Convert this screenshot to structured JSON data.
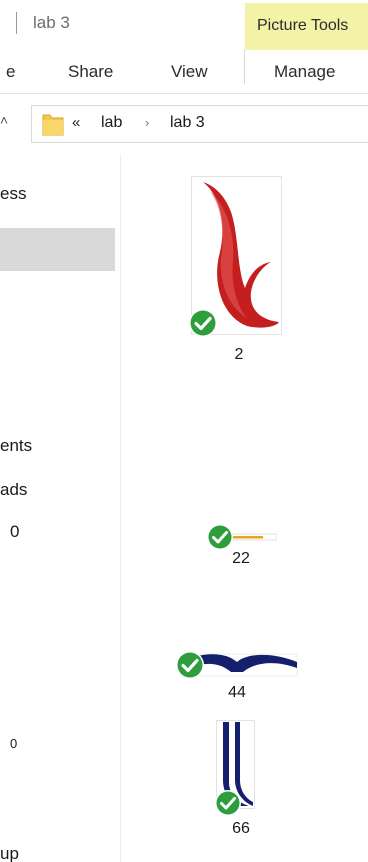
{
  "window": {
    "title": "lab 3",
    "context_tab": "Picture Tools"
  },
  "ribbon": {
    "tabs": [
      {
        "label": "e"
      },
      {
        "label": "Share"
      },
      {
        "label": "View"
      },
      {
        "label": "Manage"
      }
    ]
  },
  "address_bar": {
    "overflow": "«",
    "crumbs": [
      "lab",
      "lab 3"
    ]
  },
  "nav_pane": {
    "items": [
      "ess",
      "ents",
      "ads",
      "0",
      "0",
      "up"
    ]
  },
  "files": [
    {
      "name": "2",
      "status": "synced"
    },
    {
      "name": "22",
      "status": "synced"
    },
    {
      "name": "44",
      "status": "synced"
    },
    {
      "name": "66",
      "status": "synced"
    }
  ],
  "colors": {
    "context_tab_bg": "#f4f2a6",
    "selected_bg": "#d9d9d9",
    "folder_yellow": "#f2c94c",
    "sync_green": "#2e9e3c",
    "thumb_red": "#c41e1e",
    "thumb_navy": "#14206e",
    "thumb_orange": "#e8a41a"
  }
}
